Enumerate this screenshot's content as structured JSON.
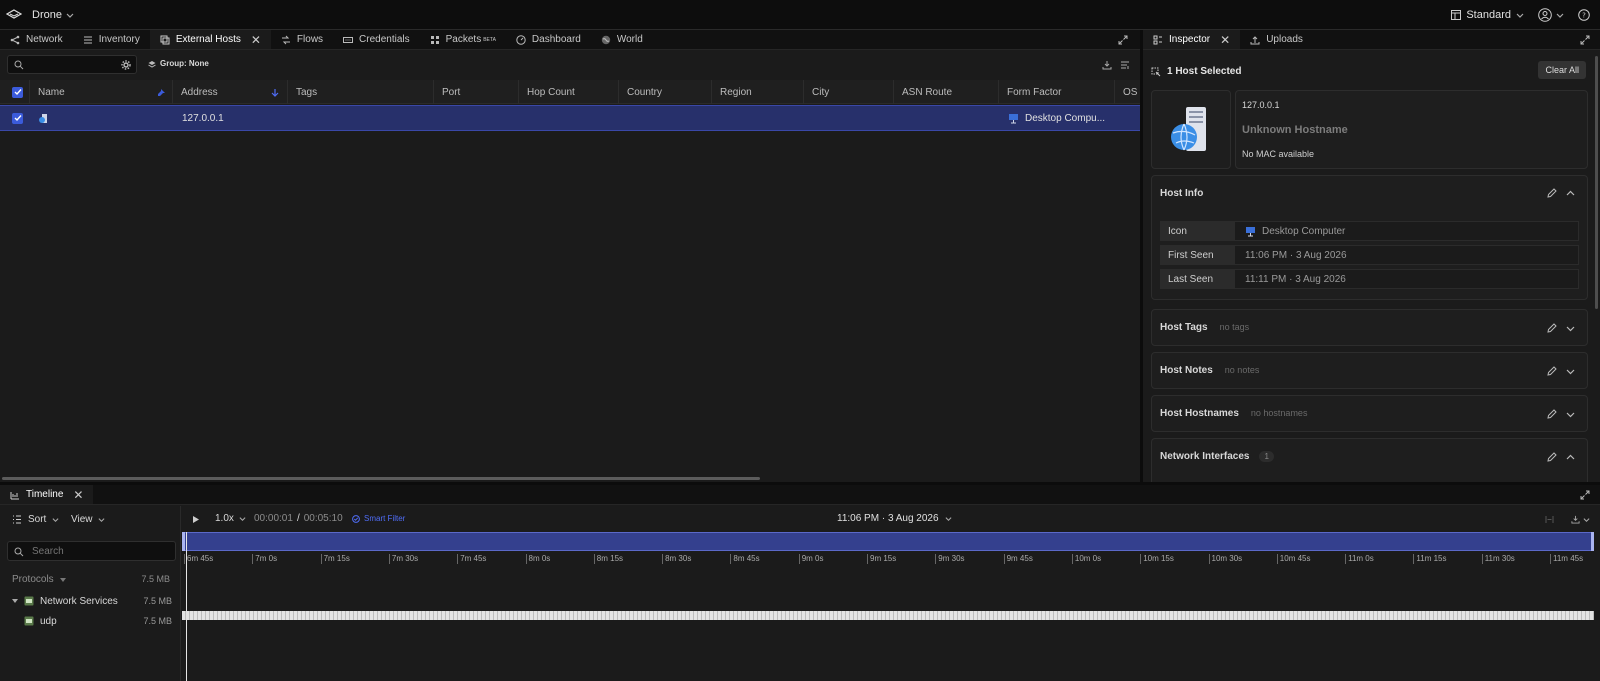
{
  "app": {
    "name": "Drone",
    "mode": "Standard"
  },
  "main_tabs": [
    {
      "label": "Network"
    },
    {
      "label": "Inventory"
    },
    {
      "label": "External Hosts"
    },
    {
      "label": "Flows"
    },
    {
      "label": "Credentials"
    },
    {
      "label": "Packets",
      "badge": "BETA"
    },
    {
      "label": "Dashboard"
    },
    {
      "label": "World"
    }
  ],
  "toolbar": {
    "search_placeholder": "",
    "group_label": "Group: None"
  },
  "table": {
    "columns": [
      "Name",
      "Address",
      "Tags",
      "Port",
      "Hop Count",
      "Country",
      "Region",
      "City",
      "ASN Route",
      "Form Factor",
      "OS"
    ],
    "rows": [
      {
        "name": "",
        "address": "127.0.0.1",
        "tags": "",
        "port": "",
        "hop_count": "",
        "country": "",
        "region": "",
        "city": "",
        "asn_route": "",
        "form_factor": "Desktop Compu...",
        "os": ""
      }
    ]
  },
  "side_tabs": [
    {
      "label": "Inspector"
    },
    {
      "label": "Uploads"
    }
  ],
  "inspector": {
    "selected_label": "1 Host Selected",
    "clear_label": "Clear All",
    "host": {
      "ip": "127.0.0.1",
      "hostname": "Unknown Hostname",
      "mac": "No MAC available"
    },
    "host_info": {
      "title": "Host Info",
      "fields": [
        {
          "key": "Icon",
          "value": "Desktop Computer"
        },
        {
          "key": "First Seen",
          "value": "11:06 PM  ·  3 Aug 2026"
        },
        {
          "key": "Last Seen",
          "value": "11:11 PM  ·  3 Aug 2026"
        }
      ]
    },
    "sections": [
      {
        "title": "Host Tags",
        "hint": "no tags"
      },
      {
        "title": "Host Notes",
        "hint": "no notes"
      },
      {
        "title": "Host Hostnames",
        "hint": "no hostnames"
      }
    ],
    "interfaces": {
      "title": "Network Interfaces",
      "count": "1"
    }
  },
  "timeline": {
    "tab_label": "Timeline",
    "sort_label": "Sort",
    "view_label": "View",
    "speed": "1.0x",
    "current_time": "00:00:01",
    "separator": "/",
    "total_time": "00:05:10",
    "smart_filter": "Smart Filter",
    "date_label": "11:06 PM  ·  3 Aug 2026",
    "search_placeholder": "Search",
    "protocols_label": "Protocols",
    "protocols_size": "7.5 MB",
    "tree": [
      {
        "label": "Network Services",
        "size": "7.5 MB"
      },
      {
        "label": "udp",
        "size": "7.5 MB"
      }
    ],
    "ticks": [
      "6m 45s",
      "7m 0s",
      "7m 15s",
      "7m 30s",
      "7m 45s",
      "8m 0s",
      "8m 15s",
      "8m 30s",
      "8m 45s",
      "9m 0s",
      "9m 15s",
      "9m 30s",
      "9m 45s",
      "10m 0s",
      "10m 15s",
      "10m 30s",
      "10m 45s",
      "11m 0s",
      "11m 15s",
      "11m 30s",
      "11m 45s"
    ]
  },
  "colors": {
    "accent": "#3b5bdb",
    "selection": "#27306b",
    "bg": "#161616"
  }
}
